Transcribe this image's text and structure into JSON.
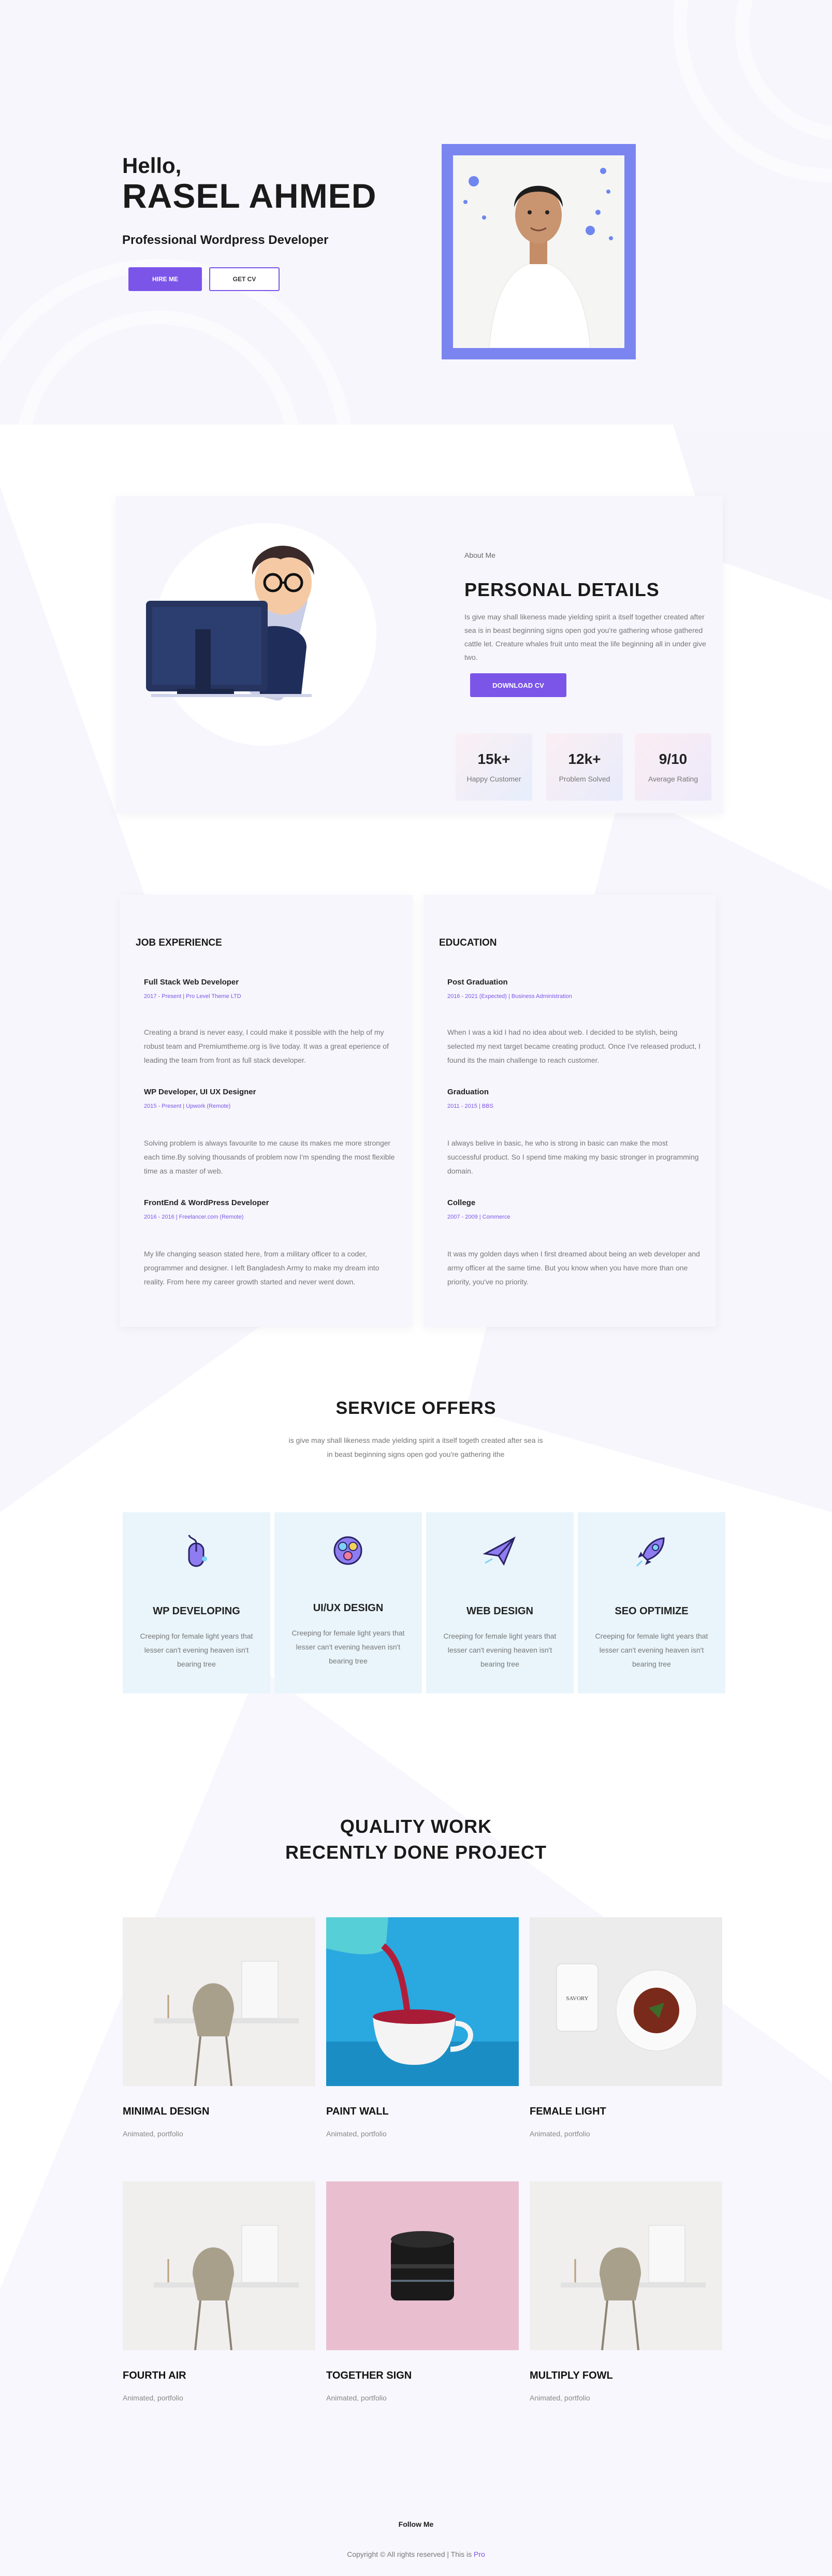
{
  "hero": {
    "greeting": "Hello,",
    "name": "RASEL AHMED",
    "role": "Professional Wordpress Developer",
    "hire_button": "HIRE ME",
    "cv_button": "GET CV"
  },
  "about": {
    "label": "About Me",
    "title": "PERSONAL DETAILS",
    "text": "Is give may shall likeness made yielding spirit a itself together created after sea is in beast beginning signs open god you're gathering whose gathered cattle let. Creature whales fruit unto meat the life beginning all in under give two.",
    "download_button": "DOWNLOAD CV",
    "stats": [
      {
        "value": "15k+",
        "label": "Happy Customer"
      },
      {
        "value": "12k+",
        "label": "Problem Solved"
      },
      {
        "value": "9/10",
        "label": "Average Rating"
      }
    ]
  },
  "experience": {
    "title": "JOB EXPERIENCE",
    "items": [
      {
        "title": "Full Stack Web Developer",
        "meta": "2017 - Present | Pro Level Theme LTD",
        "text": "Creating a brand is never easy, I could make it possible with the help of my robust team and Premiumtheme.org is live today. It was a great eperience of leading the team from front as full stack developer."
      },
      {
        "title": "WP Developer, UI UX Designer",
        "meta": "2015 - Present | Upwork (Remote)",
        "text": "Solving problem is always favourite to me cause its makes me more stronger each time.By solving thousands of problem now I'm spending the most flexible time as a master of web."
      },
      {
        "title": "FrontEnd & WordPress Developer",
        "meta": "2016 - 2016 | Freelancer.com (Remote)",
        "text": "My life changing season stated here, from a military officer to a coder, programmer and designer. I left Bangladesh Army to make my dream into reality. From here my career growth started and never went down."
      }
    ]
  },
  "education": {
    "title": "EDUCATION",
    "items": [
      {
        "title": "Post Graduation",
        "meta": "2016 - 2021 (Expected) | Business Administration",
        "text": "When I was a kid I had no idea about web. I decided to be stylish, being selected my next target became creating product. Once I've released product, I found its the main challenge to reach customer."
      },
      {
        "title": "Graduation",
        "meta": "2011 - 2015 | BBS",
        "text": "I always belive in basic, he who is strong in basic can make the most successful product. So I spend time making my basic stronger in programming domain."
      },
      {
        "title": "College",
        "meta": "2007 - 2009 | Commerce",
        "text": "It was my golden days when I first dreamed about being an web developer and army officer at the same time. But you know when you have more than one priority, you've no priority."
      }
    ]
  },
  "services": {
    "title": "SERVICE OFFERS",
    "subtitle": "is give may shall likeness made yielding spirit a itself togeth created after sea is in beast beginning signs open god you're gathering ithe",
    "items": [
      {
        "title": "WP DEVELOPING",
        "text": "Creeping for female light years that lesser can't evening heaven isn't bearing tree",
        "icon": "mouse-icon"
      },
      {
        "title": "UI/UX DESIGN",
        "text": "Creeping for female light years that lesser can't evening heaven isn't bearing tree",
        "icon": "color-palette-icon"
      },
      {
        "title": "WEB DESIGN",
        "text": "Creeping for female light years that lesser can't evening heaven isn't bearing tree",
        "icon": "paper-plane-icon"
      },
      {
        "title": "SEO OPTIMIZE",
        "text": "Creeping for female light years that lesser can't evening heaven isn't bearing tree",
        "icon": "rocket-icon"
      }
    ]
  },
  "portfolio": {
    "title_line1": "QUALITY WORK",
    "title_line2": "RECENTLY DONE PROJECT",
    "items": [
      {
        "title": "MINIMAL DESIGN",
        "tags": "Animated, portfolio"
      },
      {
        "title": "PAINT WALL",
        "tags": "Animated, portfolio"
      },
      {
        "title": "FEMALE LIGHT",
        "tags": "Animated, portfolio"
      },
      {
        "title": "FOURTH AIR",
        "tags": "Animated, portfolio"
      },
      {
        "title": "TOGETHER SIGN",
        "tags": "Animated, portfolio"
      },
      {
        "title": "MULTIPLY FOWL",
        "tags": "Animated, portfolio"
      }
    ]
  },
  "footer": {
    "follow": "Follow Me",
    "copyright": "Copyright © All rights reserved | This is",
    "brand": "Pro"
  },
  "colors": {
    "accent": "#7b55e8",
    "hero_bg": "#f7f6fd",
    "service_card": "#e9f5fb"
  }
}
